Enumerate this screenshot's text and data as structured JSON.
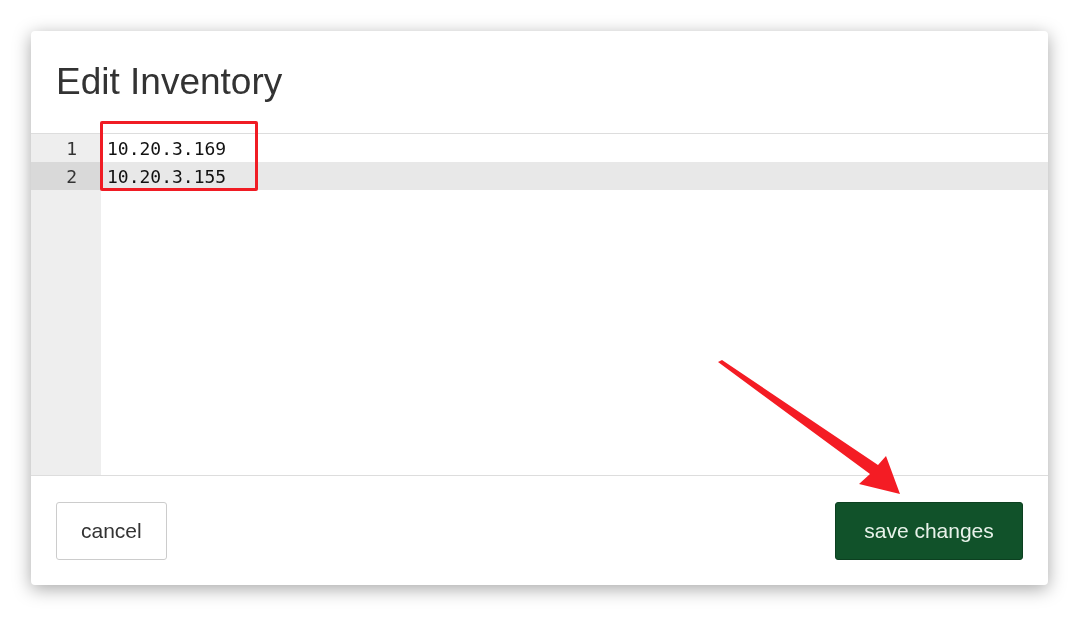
{
  "dialog": {
    "title": "Edit Inventory"
  },
  "editor": {
    "lines": [
      {
        "number": "1",
        "text": "10.20.3.169",
        "active": false
      },
      {
        "number": "2",
        "text": "10.20.3.155",
        "active": true
      }
    ]
  },
  "buttons": [
    {
      "label": "cancel",
      "kind": "secondary"
    },
    {
      "label": "save changes",
      "kind": "primary"
    }
  ]
}
